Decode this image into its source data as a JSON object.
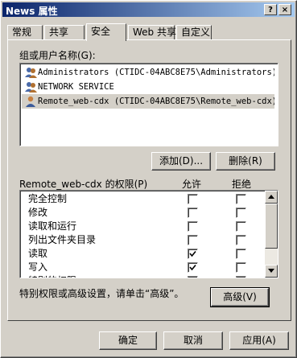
{
  "window": {
    "title": "News 属性",
    "help_button": "?",
    "close_button": "×"
  },
  "tabs": [
    {
      "label": "常规",
      "active": false
    },
    {
      "label": "共享",
      "active": false
    },
    {
      "label": "安全",
      "active": true
    },
    {
      "label": "Web 共享",
      "active": false
    },
    {
      "label": "自定义",
      "active": false
    }
  ],
  "security": {
    "users_label": "组或用户名称(G):",
    "users": [
      {
        "name": "Administrators (CTIDC-04ABC8E75\\Administrators)",
        "icon": "group-icon",
        "selected": false
      },
      {
        "name": "NETWORK SERVICE",
        "icon": "group-icon",
        "selected": false
      },
      {
        "name": "Remote_web-cdx (CTIDC-04ABC8E75\\Remote_web-cdx)",
        "icon": "user-icon",
        "selected": true
      }
    ],
    "add_button": "添加(D)...",
    "remove_button": "删除(R)",
    "permissions_label": "Remote_web-cdx 的权限(P)",
    "allow_header": "允许",
    "deny_header": "拒绝",
    "permissions": [
      {
        "name": "完全控制",
        "allow": false,
        "deny": false
      },
      {
        "name": "修改",
        "allow": false,
        "deny": false
      },
      {
        "name": "读取和运行",
        "allow": false,
        "deny": false
      },
      {
        "name": "列出文件夹目录",
        "allow": false,
        "deny": false
      },
      {
        "name": "读取",
        "allow": true,
        "deny": false
      },
      {
        "name": "写入",
        "allow": true,
        "deny": false
      },
      {
        "name": "特别的权限",
        "allow": false,
        "deny": false
      }
    ],
    "advanced_hint": "特别权限或高级设置，请单击“高级”。",
    "advanced_button": "高级(V)"
  },
  "footer": {
    "ok_button": "确定",
    "cancel_button": "取消",
    "apply_button": "应用(A)"
  }
}
